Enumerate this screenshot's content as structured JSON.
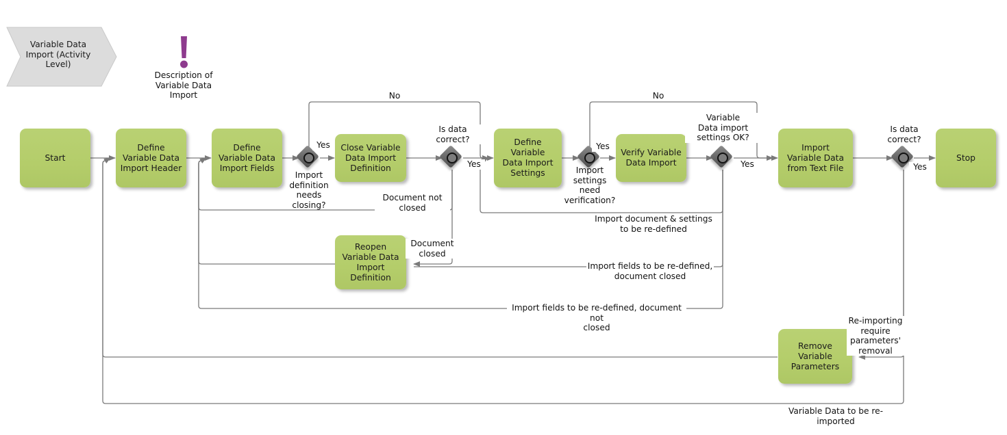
{
  "diagram": {
    "title": "Variable Data Import (Activity Level)",
    "type": "bpmn-flowchart",
    "colors": {
      "task_fill": "#b4cd6a",
      "gateway_fill": "#6d6d6d",
      "annotation_accent": "#8e3b8e",
      "edge": "#7a7a7a",
      "banner_fill": "#dddddd"
    }
  },
  "banner": {
    "label": "Variable Data\nImport (Activity\nLevel)"
  },
  "annotation": {
    "icon": "exclamation-mark-icon",
    "label": "Description of\nVariable Data\nImport"
  },
  "tasks": [
    {
      "id": "start",
      "label": "Start"
    },
    {
      "id": "define_header",
      "label": "Define\nVariable Data\nImport Header"
    },
    {
      "id": "define_fields",
      "label": "Define\nVariable Data\nImport Fields"
    },
    {
      "id": "close_def",
      "label": "Close Variable\nData Import\nDefinition"
    },
    {
      "id": "define_settings",
      "label": "Define Variable\nData Import\nSettings"
    },
    {
      "id": "verify_import",
      "label": "Verify Variable\nData Import"
    },
    {
      "id": "import_text",
      "label": "Import\nVariable Data\nfrom Text File"
    },
    {
      "id": "stop",
      "label": "Stop"
    },
    {
      "id": "reopen_def",
      "label": "Reopen\nVariable Data\nImport\nDefinition"
    },
    {
      "id": "remove_params",
      "label": "Remove\nVariable\nParameters"
    }
  ],
  "gateways": [
    {
      "id": "gw_closing",
      "label": "Import\ndefinition\nneeds\nclosing?"
    },
    {
      "id": "gw_correct1",
      "label": "Is data\ncorrect?"
    },
    {
      "id": "gw_verify",
      "label": "Import\nsettings\nneed\nverification?"
    },
    {
      "id": "gw_settings",
      "label": "Variable\nData import\nsettings OK?"
    },
    {
      "id": "gw_correct2",
      "label": "Is data\ncorrect?"
    }
  ],
  "edge_labels": {
    "no_1": "No",
    "no_2": "No",
    "yes_closing": "Yes",
    "yes_correct1": "Yes",
    "yes_verify": "Yes",
    "yes_settings": "Yes",
    "yes_correct2": "Yes",
    "doc_not_closed": "Document not\nclosed",
    "doc_closed": "Document\nclosed",
    "import_doc_settings": "Import document & settings\nto be re-defined",
    "import_fields_closed": "Import fields to be re-defined,\ndocument closed",
    "import_fields_not_closed": "Import fields to be re-defined, document not\nclosed",
    "reimport_params": "Re-importing\nrequire\nparameters'\nremoval",
    "variable_data_reimported": "Variable Data to be re-\nimported"
  }
}
